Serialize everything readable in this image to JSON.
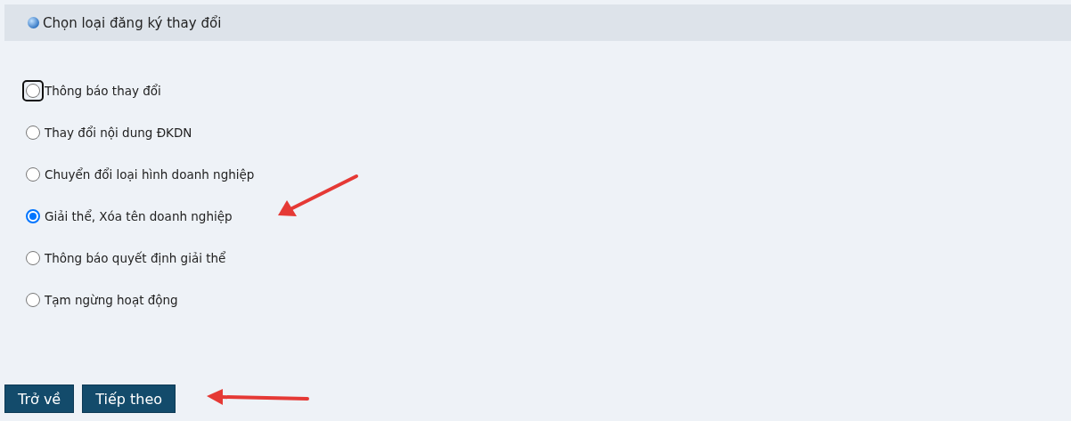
{
  "header": {
    "title": "Chọn loại đăng ký thay đổi"
  },
  "options": [
    {
      "label": "Thông báo thay đổi",
      "selected": false,
      "focused": true
    },
    {
      "label": "Thay đổi nội dung ĐKDN",
      "selected": false,
      "focused": false
    },
    {
      "label": "Chuyển đổi loại hình doanh nghiệp",
      "selected": false,
      "focused": false
    },
    {
      "label": "Giải thể, Xóa tên doanh nghiệp",
      "selected": true,
      "focused": false
    },
    {
      "label": "Thông báo quyết định giải thể",
      "selected": false,
      "focused": false
    },
    {
      "label": "Tạm ngừng hoạt động",
      "selected": false,
      "focused": false
    }
  ],
  "buttons": [
    "Trở về",
    "Tiếp theo"
  ]
}
